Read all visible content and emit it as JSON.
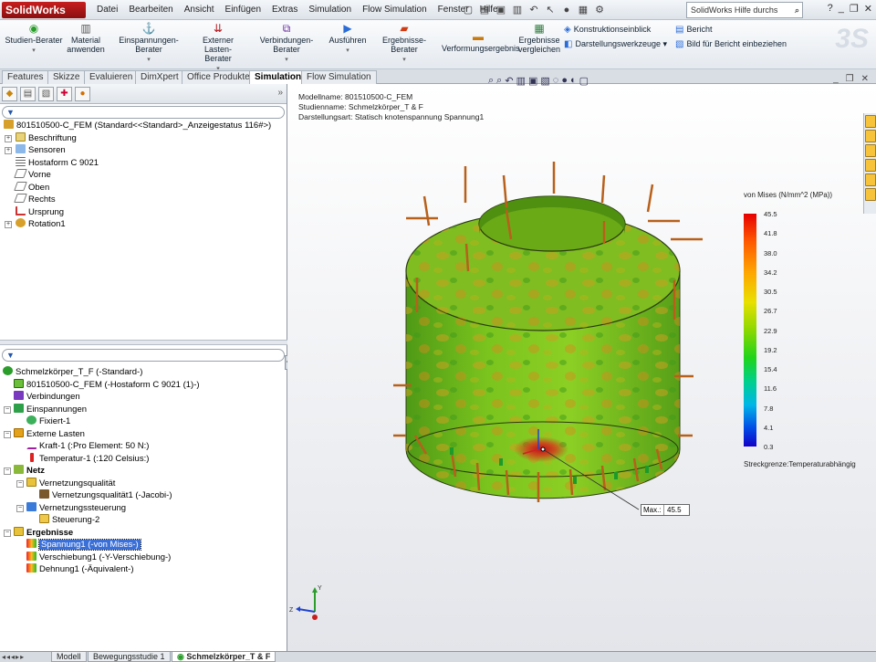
{
  "app": {
    "brand": "SolidWorks",
    "accent": "#c81e1e"
  },
  "menu": {
    "items": [
      "Datei",
      "Bearbeiten",
      "Ansicht",
      "Einfügen",
      "Extras",
      "Simulation",
      "Flow Simulation",
      "Fenster",
      "Hilfe"
    ]
  },
  "help_search": {
    "placeholder": "SolidWorks Hilfe durchs"
  },
  "ribbon": {
    "buttons": [
      {
        "label": "Studien-Berater",
        "icon": "study-icon"
      },
      {
        "label": "Material anwenden",
        "icon": "material-icon"
      },
      {
        "label": "Einspannungen-Berater",
        "icon": "fixture-icon"
      },
      {
        "label": "Externer Lasten-Berater",
        "icon": "load-icon"
      },
      {
        "label": "Verbindungen-Berater",
        "icon": "connection-icon"
      },
      {
        "label": "Ausführen",
        "icon": "run-icon"
      },
      {
        "label": "Ergebnisse-Berater",
        "icon": "results-icon"
      },
      {
        "label": "Verformungsergebnis",
        "icon": "deform-icon"
      },
      {
        "label": "Ergebnisse vergleichen",
        "icon": "compare-icon"
      }
    ],
    "small": [
      {
        "label": "Konstruktionseinblick",
        "icon": "insight-icon"
      },
      {
        "label": "Darstellungswerkzeuge",
        "icon": "plot-tools-icon"
      },
      {
        "label": "Bericht",
        "icon": "report-icon"
      },
      {
        "label": "Bild für Bericht einbeziehen",
        "icon": "image-report-icon"
      }
    ]
  },
  "tabs": {
    "items": [
      "Features",
      "Skizze",
      "Evaluieren",
      "DimXpert",
      "Office Produkte",
      "Simulation",
      "Flow Simulation"
    ],
    "active": "Simulation"
  },
  "feature_tree": {
    "root": "801510500-C_FEM  (Standard<<Standard>_Anzeigestatus 116#>)",
    "items": [
      "Beschriftung",
      "Sensoren",
      "Hostaform C 9021",
      "Vorne",
      "Oben",
      "Rechts",
      "Ursprung",
      "Rotation1"
    ]
  },
  "sim_tree": {
    "study": "Schmelzkörper_T_F (-Standard-)",
    "part": "801510500-C_FEM (-Hostaform C 9021 (1)-)",
    "verbindungen": "Verbindungen",
    "einspannungen": "Einspannungen",
    "fixiert": "Fixiert-1",
    "externe_lasten": "Externe Lasten",
    "kraft": "Kraft-1 (:Pro Element: 50 N:)",
    "temperatur": "Temperatur-1 (:120 Celsius:)",
    "netz": "Netz",
    "vernetzungsqualitaet": "Vernetzungsqualität",
    "vernetzungsqualitaet1": "Vernetzungsqualität1 (-Jacobi-)",
    "vernetzungssteuerung": "Vernetzungssteuerung",
    "steuerung": "Steuerung-2",
    "ergebnisse": "Ergebnisse",
    "spannung": "Spannung1 (-von Mises-)",
    "verschiebung": "Verschiebung1 (-Y-Verschiebung-)",
    "dehnung": "Dehnung1 (-Äquivalent-)"
  },
  "graphics": {
    "model_name": "Modellname: 801510500-C_FEM",
    "study_name": "Studienname: Schmelzkörper_T & F",
    "plot_type": "Darstellungsart: Statisch knotenspannung Spannung1",
    "legend_title": "von Mises (N/mm^2 (MPa))",
    "legend_values": [
      "45.5",
      "41.8",
      "38.0",
      "34.2",
      "30.5",
      "26.7",
      "22.9",
      "19.2",
      "15.4",
      "11.6",
      "7.8",
      "4.1",
      "0.3"
    ],
    "yield": "Streckgrenze:Temperaturabhängig",
    "max_label": "Max.:",
    "max_value": "45.5"
  },
  "bottom_tabs": {
    "items": [
      "Modell",
      "Bewegungsstudie 1",
      "Schmelzkörper_T & F"
    ],
    "active": "Schmelzkörper_T & F"
  }
}
